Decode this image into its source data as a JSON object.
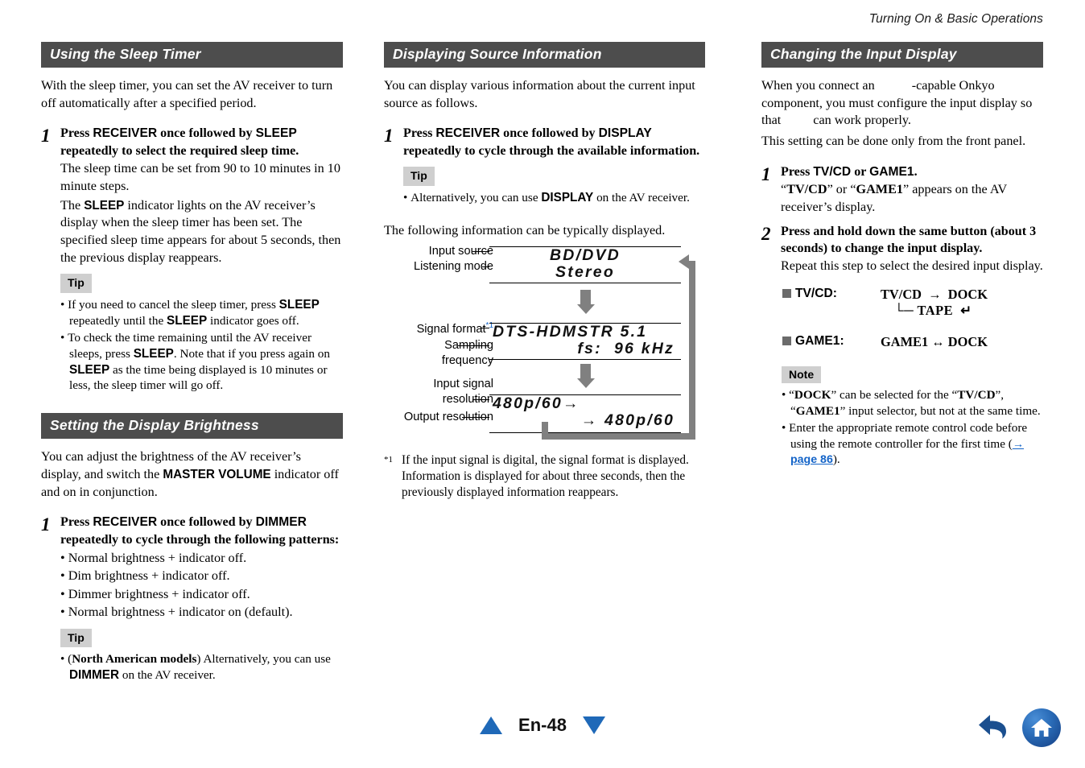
{
  "header": {
    "running_title": "Turning On & Basic Operations"
  },
  "col1": {
    "section1": {
      "title": "Using the Sleep Timer",
      "intro": "With the sleep timer, you can set the AV receiver to turn off automatically after a specified period.",
      "step": {
        "num": "1",
        "head_a": "Press ",
        "head_b": "RECEIVER",
        "head_c": " once followed by ",
        "head_d": "SLEEP",
        "head_e": " repeatedly to select the required sleep time.",
        "p1": "The sleep time can be set from 90 to 10 minutes in 10 minute steps.",
        "p2_a": "The ",
        "p2_b": "SLEEP",
        "p2_c": " indicator lights on the AV receiver’s display when the sleep timer has been set. The specified sleep time appears for about 5 seconds, then the previous display reappears."
      },
      "tip": {
        "label": "Tip",
        "item1_a": "If you need to cancel the sleep timer, press ",
        "item1_b": "SLEEP",
        "item1_c": " repeatedly until the ",
        "item1_d": "SLEEP",
        "item1_e": " indicator goes off.",
        "item2_a": "To check the time remaining until the AV receiver sleeps, press ",
        "item2_b": "SLEEP",
        "item2_c": ". Note that if you press again on ",
        "item2_d": "SLEEP",
        "item2_e": " as the time being displayed is 10 minutes or less, the sleep timer will go off."
      }
    },
    "section2": {
      "title": "Setting the Display Brightness",
      "intro_a": "You can adjust the brightness of the AV receiver’s display, and switch the ",
      "intro_b": "MASTER VOLUME",
      "intro_c": " indicator off and on in conjunction.",
      "step": {
        "num": "1",
        "head_a": "Press ",
        "head_b": "RECEIVER",
        "head_c": " once followed by ",
        "head_d": "DIMMER",
        "head_e": " repeatedly to cycle through the following patterns:",
        "bullets": [
          "Normal brightness + indicator off.",
          "Dim brightness + indicator off.",
          "Dimmer brightness + indicator off.",
          "Normal brightness + indicator on (default)."
        ]
      },
      "tip": {
        "label": "Tip",
        "item1_a": "(",
        "item1_b": "North American models",
        "item1_c": ") Alternatively, you can use ",
        "item1_d": "DIMMER",
        "item1_e": " on the AV receiver."
      }
    }
  },
  "col2": {
    "section": {
      "title": "Displaying Source Information",
      "intro": "You can display various information about the current input source as follows.",
      "step": {
        "num": "1",
        "head_a": "Press ",
        "head_b": "RECEIVER",
        "head_c": " once followed by ",
        "head_d": "DISPLAY",
        "head_e": " repeatedly to cycle through the available information."
      },
      "tip": {
        "label": "Tip",
        "item1_a": "Alternatively, you can use ",
        "item1_b": "DISPLAY",
        "item1_c": " on the AV receiver."
      },
      "after_tip": "The following information can be typically displayed."
    },
    "diagram": {
      "labels": {
        "input_source": "Input source",
        "listening_mode": "Listening mode",
        "signal_format": "Signal format",
        "signal_format_fn": "*1",
        "sampling": "Sampling",
        "frequency": "frequency",
        "input_signal": "Input signal",
        "resolution": "resolution",
        "output_resolution": "Output resolution"
      },
      "screens": [
        {
          "line1": "BD/DVD",
          "line2": "Stereo"
        },
        {
          "line1": "DTS-HDMSTR 5.1",
          "line2": "fs:  96 kHz"
        },
        {
          "line1": "480p/60→",
          "line2": "→ 480p/60"
        }
      ]
    },
    "footnote": {
      "mark": "*1",
      "text": "If the input signal is digital, the signal format is displayed. Information is displayed for about three seconds, then the previously displayed information reappears."
    }
  },
  "col3": {
    "section": {
      "title": "Changing the Input Display",
      "intro_a": "When you connect an",
      "intro_b": "-capable Onkyo component, you must configure the input display so that",
      "intro_c": "can work properly.",
      "intro2": "This setting can be done only from the front panel.",
      "step1": {
        "num": "1",
        "head_a": "Press ",
        "head_b": "TV/CD",
        "head_c": " or ",
        "head_d": "GAME1",
        "head_e": ".",
        "p1_a": "“",
        "p1_b": "TV/CD",
        "p1_c": "” or “",
        "p1_d": "GAME1",
        "p1_e": "” appears on the AV receiver’s display."
      },
      "step2": {
        "num": "2",
        "head": "Press and hold down the same button (about 3 seconds) to change the input display.",
        "p1": "Repeat this step to select the desired input display."
      },
      "cycles": [
        {
          "key": "TV/CD:",
          "line1": "TV/CD  →  DOCK",
          "line2": "└─ TAPE  ↵"
        },
        {
          "key": "GAME1:",
          "line1": "GAME1 ↔ DOCK",
          "line2": ""
        }
      ],
      "note": {
        "label": "Note",
        "item1_a": "“",
        "item1_b": "DOCK",
        "item1_c": "” can be selected for the “",
        "item1_d": "TV/CD",
        "item1_e": "”, “",
        "item1_f": "GAME1",
        "item1_g": "” input selector, but not at the same time.",
        "item2_a": "Enter the appropriate remote control code before using the remote controller for the first time (",
        "item2_link": "→ page 86",
        "item2_b": ")."
      }
    }
  },
  "footer": {
    "page_label": "En-48",
    "prev_icon": "triangle-up-icon",
    "next_icon": "triangle-down-icon",
    "back_icon": "back-arrow-icon",
    "home_icon": "home-icon"
  },
  "colors": {
    "section_bar": "#4d4d4d",
    "link_blue": "#1464c8",
    "nav_blue": "#1f69b8",
    "callout_gray": "#cfcfcf",
    "arrow_gray": "#808080"
  }
}
